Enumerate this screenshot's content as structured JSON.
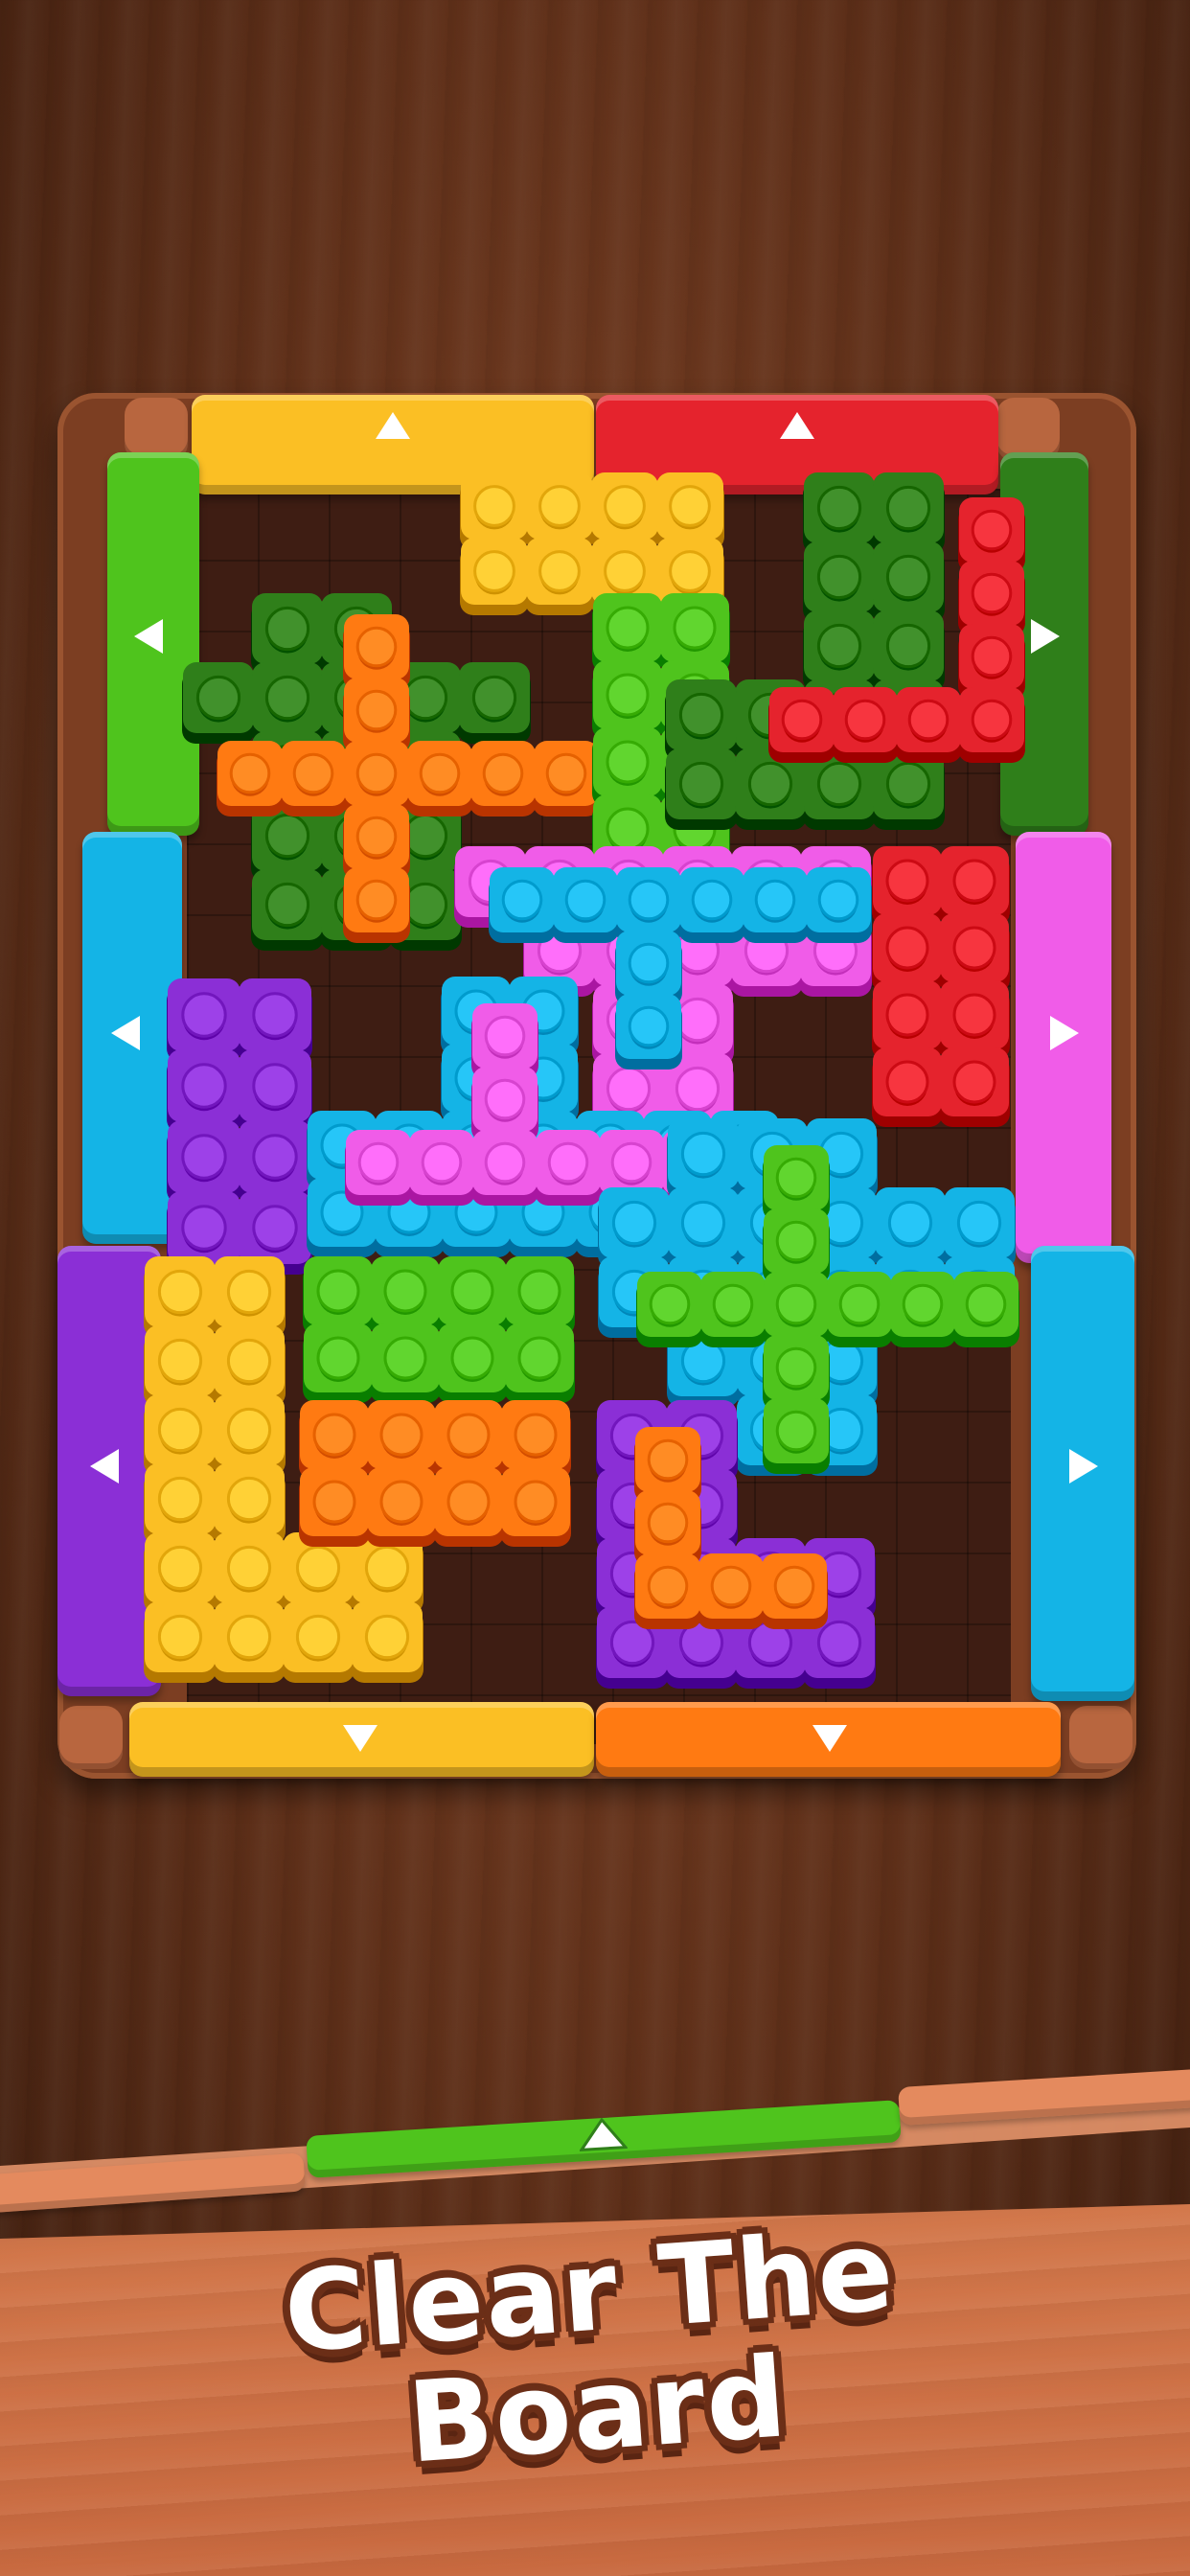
{
  "caption": {
    "line1": "Clear The",
    "line2": "Board"
  },
  "colors": {
    "yellow": "#fbbf24",
    "red": "#e5232d",
    "green": "#4fc41d",
    "dark_green": "#2f7f1a",
    "orange": "#ff7a12",
    "blue": "#14b4e6",
    "pink": "#f05ce8",
    "purple": "#8b2fd6"
  },
  "gates": [
    {
      "name": "gate-top-yellow",
      "color": "yellow",
      "arrow": "up"
    },
    {
      "name": "gate-top-red",
      "color": "red",
      "arrow": "up"
    },
    {
      "name": "gate-left-green",
      "color": "green",
      "arrow": "left"
    },
    {
      "name": "gate-left-blue",
      "color": "blue",
      "arrow": "left"
    },
    {
      "name": "gate-left-purple",
      "color": "purple",
      "arrow": "left"
    },
    {
      "name": "gate-right-dark-green",
      "color": "dark_green",
      "arrow": "right"
    },
    {
      "name": "gate-right-pink",
      "color": "pink",
      "arrow": "right"
    },
    {
      "name": "gate-right-blue",
      "color": "blue",
      "arrow": "right"
    },
    {
      "name": "gate-bottom-yellow",
      "color": "yellow",
      "arrow": "down"
    },
    {
      "name": "gate-bottom-orange",
      "color": "orange",
      "arrow": "down"
    },
    {
      "name": "gate-shelf-green",
      "color": "green",
      "arrow": "up"
    }
  ],
  "pieces": [
    {
      "name": "yellow-bar-piece",
      "color": "yellow"
    },
    {
      "name": "dark-green-plus-piece",
      "color": "dark_green"
    },
    {
      "name": "orange-plus-piece",
      "color": "orange"
    },
    {
      "name": "green-bar-piece",
      "color": "green"
    },
    {
      "name": "dark-green-base-piece",
      "color": "dark_green"
    },
    {
      "name": "red-l-piece",
      "color": "red"
    },
    {
      "name": "pink-t-piece",
      "color": "pink"
    },
    {
      "name": "blue-t-piece",
      "color": "blue"
    },
    {
      "name": "red-block-piece",
      "color": "red"
    },
    {
      "name": "purple-block-piece",
      "color": "purple"
    },
    {
      "name": "blue-t-lower-piece",
      "color": "blue"
    },
    {
      "name": "pink-t-lower-piece",
      "color": "pink"
    },
    {
      "name": "blue-plus-piece",
      "color": "blue"
    },
    {
      "name": "green-plus-piece",
      "color": "green"
    },
    {
      "name": "yellow-l-piece",
      "color": "yellow"
    },
    {
      "name": "green-bar-lower-piece",
      "color": "green"
    },
    {
      "name": "orange-bar-piece",
      "color": "orange"
    },
    {
      "name": "purple-l-piece",
      "color": "purple"
    },
    {
      "name": "orange-l-piece",
      "color": "orange"
    }
  ]
}
